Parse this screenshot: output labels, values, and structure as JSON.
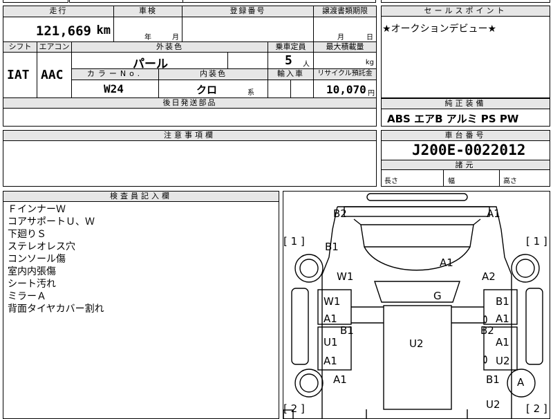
{
  "top_cells": [
    "",
    "",
    ""
  ],
  "spec": {
    "mileage_label": "走行",
    "mileage": "121,669",
    "mileage_unit": "km",
    "inspection_label": "車検",
    "inspection_year": "年",
    "inspection_month": "月",
    "reg_label": "登録番号",
    "transfer_label": "譲渡書類期限",
    "transfer_month": "月",
    "transfer_day": "日",
    "shift_label": "シフト",
    "shift": "IAT",
    "ac_label": "エアコン",
    "ac": "AAC",
    "ext_color_label": "外装色",
    "ext_color": "パール",
    "capacity_label": "乗車定員",
    "capacity": "5",
    "capacity_unit": "人",
    "max_load_label": "最大積載量",
    "max_load_unit": "kg",
    "color_no_label": "カラーNo.",
    "color_no": "W24",
    "int_color_label": "内装色",
    "int_color": "クロ",
    "int_color_suffix": "系",
    "import_label": "輸入車",
    "recycle_label": "リサイクル預託金",
    "recycle": "10,070",
    "recycle_unit": "円",
    "later_parts_label": "後日発送部品"
  },
  "sales": {
    "label": "セールスポイント",
    "text": "★オークションデビュー★"
  },
  "equipment": {
    "label": "純正装備",
    "text": "ABS エアB アルミ PS PW"
  },
  "caution": {
    "label": "注意事項欄"
  },
  "chassis": {
    "label": "車台番号",
    "number": "J200E-0022012",
    "dims_label": "諸元",
    "length": "長さ",
    "width": "幅",
    "height": "高さ"
  },
  "inspector": {
    "label": "検査員記入欄",
    "notes": [
      "ＦインナーＷ",
      "コアサポートＵ、Ｗ",
      "下廻りＳ",
      "ステレオレス穴",
      "コンソール傷",
      "室内内張傷",
      "シート汚れ",
      "ミラーＡ",
      "背面タイヤカバー割れ"
    ]
  },
  "diagram": {
    "marks": {
      "b2_top": "B2",
      "a1_top": "A1",
      "b1_front": "B1",
      "a1_hood": "A1",
      "w1_front": "W1",
      "a2_front": "A2",
      "g_glass": "G",
      "w1_left": "W1",
      "a1_left_door1": "A1",
      "b1_right_door1": "B1",
      "a1_right_door1": "A1",
      "b1_left_pillar": "B1",
      "b2_right_pillar": "B2",
      "u1_left": "U1",
      "a1_left_door2": "A1",
      "u2_roof": "U2",
      "a1_right_door2": "A1",
      "u2_right_door2": "U2",
      "a1_rear_left": "A1",
      "b1_rear_right": "B1",
      "a_spare": "A",
      "u2_rear": "U2"
    },
    "bracket_1": "[ 1 ]",
    "bracket_2": "[ 2 ]"
  }
}
